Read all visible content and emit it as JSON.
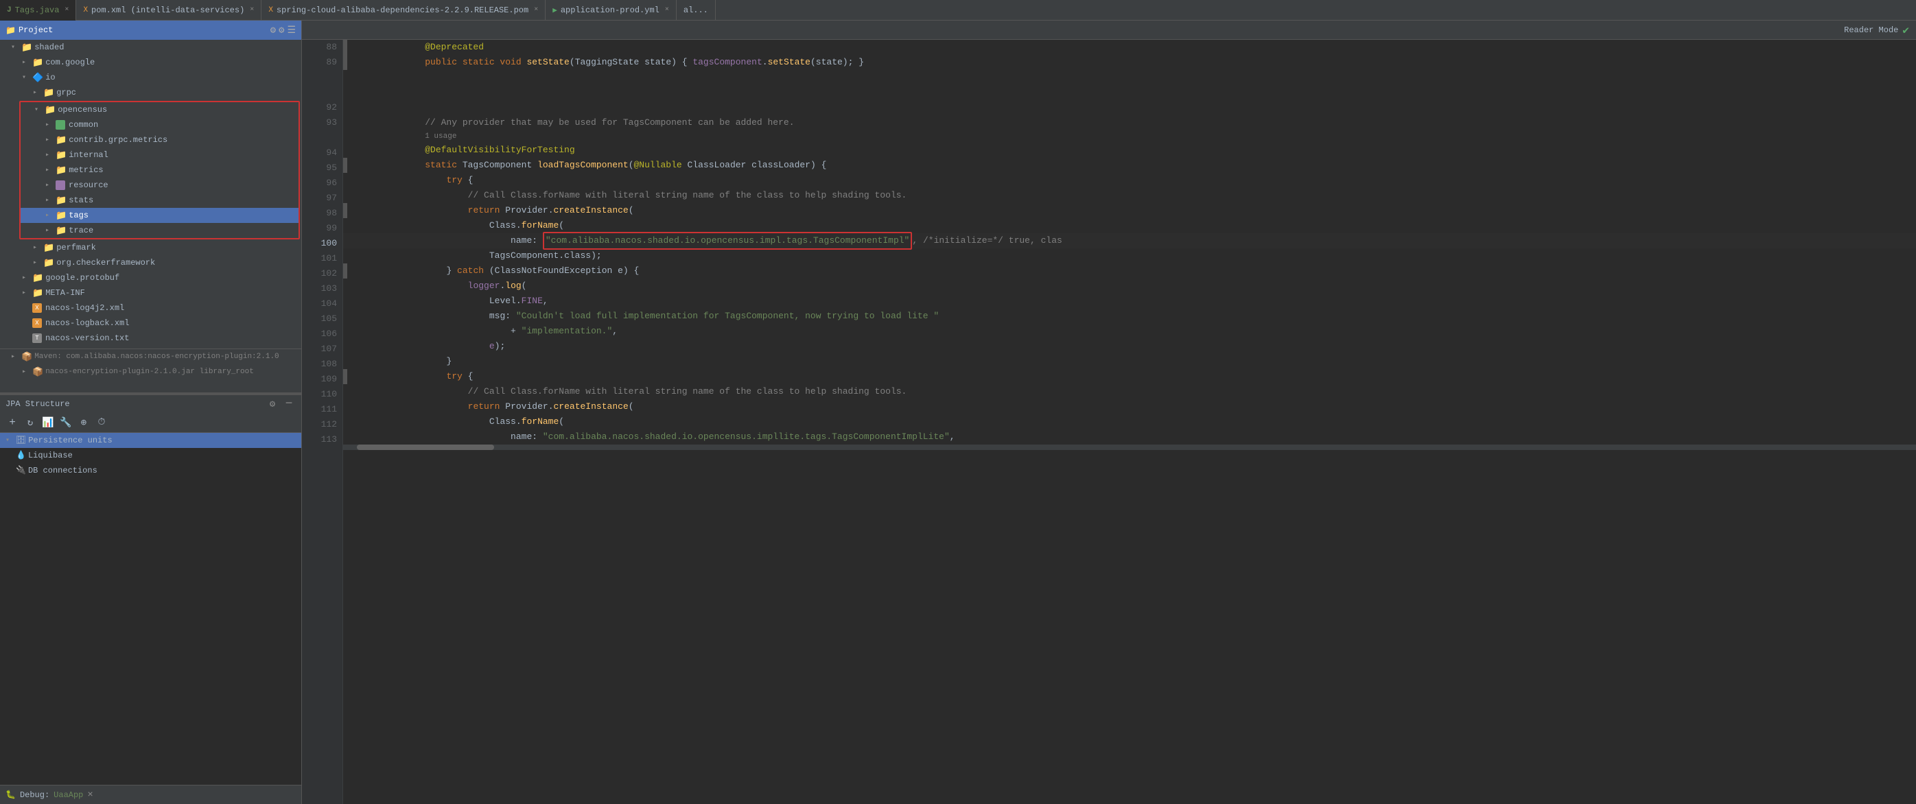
{
  "tabs": [
    {
      "label": "Tags.java",
      "active": true,
      "color": "#6a8759",
      "closeable": true
    },
    {
      "label": "pom.xml (intelli-data-services)",
      "active": false,
      "closeable": true
    },
    {
      "label": "spring-cloud-alibaba-dependencies-2.2.9.RELEASE.pom",
      "active": false,
      "closeable": true
    },
    {
      "label": "application-prod.yml",
      "active": false,
      "closeable": true
    },
    {
      "label": "al...",
      "active": false,
      "closeable": false
    }
  ],
  "project_header": {
    "label": "Project",
    "icon": "project-icon"
  },
  "tree": [
    {
      "id": 1,
      "indent": 1,
      "label": "shaded",
      "type": "folder",
      "open": true
    },
    {
      "id": 2,
      "indent": 2,
      "label": "com.google",
      "type": "folder",
      "open": false
    },
    {
      "id": 3,
      "indent": 2,
      "label": "io",
      "type": "folder",
      "open": true,
      "icon": "io-pkg"
    },
    {
      "id": 4,
      "indent": 3,
      "label": "grpc",
      "type": "folder",
      "open": false
    },
    {
      "id": 5,
      "indent": 3,
      "label": "opencensus",
      "type": "folder",
      "open": true,
      "red_border_start": true
    },
    {
      "id": 6,
      "indent": 4,
      "label": "common",
      "type": "folder",
      "open": false,
      "icon": "green-pkg"
    },
    {
      "id": 7,
      "indent": 4,
      "label": "contrib.grpc.metrics",
      "type": "folder",
      "open": false
    },
    {
      "id": 8,
      "indent": 4,
      "label": "internal",
      "type": "folder",
      "open": false
    },
    {
      "id": 9,
      "indent": 4,
      "label": "metrics",
      "type": "folder",
      "open": false
    },
    {
      "id": 10,
      "indent": 4,
      "label": "resource",
      "type": "folder",
      "open": false,
      "icon": "purple-pkg"
    },
    {
      "id": 11,
      "indent": 4,
      "label": "stats",
      "type": "folder",
      "open": false
    },
    {
      "id": 12,
      "indent": 4,
      "label": "tags",
      "type": "folder",
      "open": false,
      "selected": true,
      "red_border_end": true
    },
    {
      "id": 13,
      "indent": 4,
      "label": "trace",
      "type": "folder",
      "open": false
    },
    {
      "id": 14,
      "indent": 3,
      "label": "perfmark",
      "type": "folder",
      "open": false
    },
    {
      "id": 15,
      "indent": 3,
      "label": "org.checkerframework",
      "type": "folder",
      "open": false
    },
    {
      "id": 16,
      "indent": 2,
      "label": "google.protobuf",
      "type": "folder",
      "open": false
    },
    {
      "id": 17,
      "indent": 2,
      "label": "META-INF",
      "type": "folder",
      "open": false
    },
    {
      "id": 18,
      "indent": 2,
      "label": "nacos-log4j2.xml",
      "type": "file",
      "icon": "xml-file"
    },
    {
      "id": 19,
      "indent": 2,
      "label": "nacos-logback.xml",
      "type": "file",
      "icon": "xml-file"
    },
    {
      "id": 20,
      "indent": 2,
      "label": "nacos-version.txt",
      "type": "file",
      "icon": "txt-file"
    }
  ],
  "maven_items": [
    {
      "label": "Maven: com.alibaba.nacos:nacos-encryption-plugin:2.1.0",
      "indent": 1
    },
    {
      "label": "nacos-encryption-plugin-2.1.0.jar library_root",
      "indent": 2
    }
  ],
  "jpa_panel": {
    "title": "JPA Structure",
    "items": [
      {
        "label": "Persistence units",
        "indent": 1,
        "type": "group",
        "selected": true
      },
      {
        "label": "Liquibase",
        "indent": 1,
        "type": "item"
      },
      {
        "label": "DB connections",
        "indent": 1,
        "type": "item"
      }
    ]
  },
  "debug_bar": {
    "label": "Debug:",
    "app": "UaaApp",
    "close_icon": "×"
  },
  "editor": {
    "reader_mode_label": "Reader Mode",
    "lines": [
      {
        "num": 88,
        "content": [
          {
            "type": "annotation",
            "text": "@Deprecated"
          }
        ]
      },
      {
        "num": 89,
        "content": [
          {
            "type": "kw",
            "text": "public static void "
          },
          {
            "type": "method",
            "text": "setState"
          },
          {
            "type": "text",
            "text": "("
          },
          {
            "type": "type",
            "text": "TaggingState"
          },
          {
            "type": "text",
            "text": " state) { "
          },
          {
            "type": "var",
            "text": "tagsComponent"
          },
          {
            "type": "text",
            "text": "."
          },
          {
            "type": "method",
            "text": "setState"
          },
          {
            "type": "text",
            "text": "(state); }"
          }
        ]
      },
      {
        "num": 92,
        "content": []
      },
      {
        "num": 93,
        "content": [
          {
            "type": "comment",
            "text": "// Any provider that may be used for TagsComponent can be added here."
          }
        ]
      },
      {
        "num": "93b",
        "content": [
          {
            "type": "usage",
            "text": "1 usage"
          }
        ]
      },
      {
        "num": 94,
        "content": [
          {
            "type": "annotation",
            "text": "@DefaultVisibilityForTesting"
          }
        ]
      },
      {
        "num": 95,
        "content": [
          {
            "type": "kw",
            "text": "static "
          },
          {
            "type": "type",
            "text": "TagsComponent"
          },
          {
            "type": "text",
            "text": " "
          },
          {
            "type": "method",
            "text": "loadTagsComponent"
          },
          {
            "type": "text",
            "text": "("
          },
          {
            "type": "annotation",
            "text": "@Nullable"
          },
          {
            "type": "text",
            "text": " "
          },
          {
            "type": "type",
            "text": "ClassLoader"
          },
          {
            "type": "text",
            "text": " classLoader) {"
          }
        ]
      },
      {
        "num": 96,
        "content": [
          {
            "type": "kw",
            "text": "try"
          },
          {
            "type": "text",
            "text": " {"
          }
        ]
      },
      {
        "num": 97,
        "content": [
          {
            "type": "comment",
            "text": "// Call Class.forName with literal string name of the class to help shading tools."
          }
        ]
      },
      {
        "num": 98,
        "content": [
          {
            "type": "kw",
            "text": "return"
          },
          {
            "type": "text",
            "text": " "
          },
          {
            "type": "type",
            "text": "Provider"
          },
          {
            "type": "text",
            "text": "."
          },
          {
            "type": "method",
            "text": "createInstance"
          },
          {
            "type": "text",
            "text": "("
          }
        ]
      },
      {
        "num": 99,
        "content": [
          {
            "type": "type",
            "text": "Class"
          },
          {
            "type": "text",
            "text": "."
          },
          {
            "type": "method",
            "text": "forName"
          },
          {
            "type": "text",
            "text": "("
          }
        ]
      },
      {
        "num": 100,
        "content": [
          {
            "type": "text",
            "text": "name: "
          },
          {
            "type": "str_highlighted",
            "text": "\"com.alibaba.nacos.shaded.io.opencensus.impl.tags.TagsComponentImpl\""
          },
          {
            "type": "comment",
            "text": ", /*initialize=*/ true, clas"
          }
        ],
        "has_red_box": true
      },
      {
        "num": 101,
        "content": [
          {
            "type": "type",
            "text": "TagsComponent"
          },
          {
            "type": "text",
            "text": ".class);"
          }
        ]
      },
      {
        "num": 102,
        "content": [
          {
            "type": "text",
            "text": "} "
          },
          {
            "type": "kw",
            "text": "catch"
          },
          {
            "type": "text",
            "text": " ("
          },
          {
            "type": "type",
            "text": "ClassNotFoundException"
          },
          {
            "type": "text",
            "text": " e) {"
          }
        ]
      },
      {
        "num": 103,
        "content": [
          {
            "type": "var",
            "text": "logger"
          },
          {
            "type": "text",
            "text": "."
          },
          {
            "type": "method",
            "text": "log"
          },
          {
            "type": "text",
            "text": "("
          }
        ]
      },
      {
        "num": 104,
        "content": [
          {
            "type": "type",
            "text": "Level"
          },
          {
            "type": "text",
            "text": "."
          },
          {
            "type": "var",
            "text": "FINE"
          },
          {
            "type": "text",
            "text": ","
          }
        ]
      },
      {
        "num": 105,
        "content": [
          {
            "type": "text",
            "text": "msg: "
          },
          {
            "type": "str",
            "text": "\"Couldn't load full implementation for TagsComponent, now trying to load lite \""
          }
        ]
      },
      {
        "num": 106,
        "content": [
          {
            "type": "text",
            "text": "+ "
          },
          {
            "type": "str",
            "text": "\"implementation.\""
          }
        ],
        "indent": 4
      },
      {
        "num": 107,
        "content": [
          {
            "type": "var",
            "text": "e"
          },
          {
            "type": "text",
            "text": ");"
          }
        ]
      },
      {
        "num": 108,
        "content": [
          {
            "type": "text",
            "text": "}"
          }
        ]
      },
      {
        "num": 109,
        "content": [
          {
            "type": "kw",
            "text": "try"
          },
          {
            "type": "text",
            "text": " {"
          }
        ]
      },
      {
        "num": 110,
        "content": [
          {
            "type": "comment",
            "text": "// Call Class.forName with literal string name of the class to help shading tools."
          }
        ]
      },
      {
        "num": 111,
        "content": [
          {
            "type": "kw",
            "text": "return"
          },
          {
            "type": "text",
            "text": " "
          },
          {
            "type": "type",
            "text": "Provider"
          },
          {
            "type": "text",
            "text": "."
          },
          {
            "type": "method",
            "text": "createInstance"
          },
          {
            "type": "text",
            "text": "("
          }
        ]
      },
      {
        "num": 112,
        "content": [
          {
            "type": "type",
            "text": "Class"
          },
          {
            "type": "text",
            "text": "."
          },
          {
            "type": "method",
            "text": "forName"
          },
          {
            "type": "text",
            "text": "("
          }
        ]
      },
      {
        "num": 113,
        "content": [
          {
            "type": "text",
            "text": "name: "
          },
          {
            "type": "str",
            "text": "\"com.alibaba.nacos.shaded.io.opencensus.impllite.tags.TagsComponentImplLite\""
          }
        ],
        "indent": 2
      }
    ]
  }
}
